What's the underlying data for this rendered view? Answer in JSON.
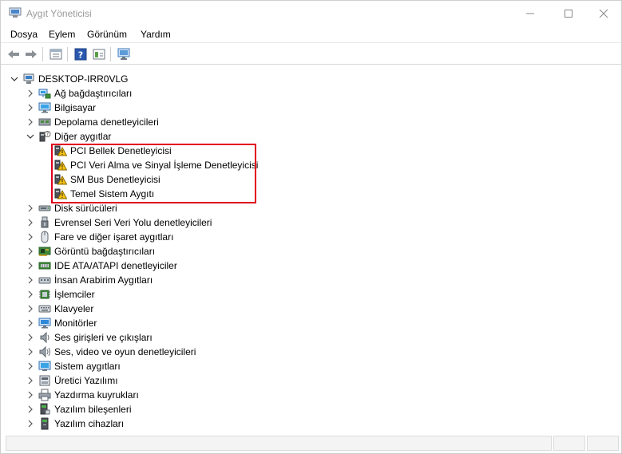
{
  "window": {
    "title": "Aygıt Yöneticisi",
    "controls": {
      "minimize": "—",
      "maximize": "☐",
      "close": "✕"
    }
  },
  "menu": {
    "items": [
      "Dosya",
      "Eylem",
      "Görünüm",
      "Yardım"
    ]
  },
  "toolbar": {
    "icons": [
      "back-arrow-icon",
      "forward-arrow-icon",
      "properties-icon",
      "help-icon",
      "view-icon",
      "scan-hardware-icon"
    ]
  },
  "tree": {
    "root": {
      "label": "DESKTOP-IRR0VLG",
      "icon": "computer-icon",
      "expanded": true
    },
    "categories": [
      {
        "label": "Ağ bağdaştırıcıları",
        "icon": "network-adapter-icon",
        "expanded": false
      },
      {
        "label": "Bilgisayar",
        "icon": "computer-monitor-icon",
        "expanded": false
      },
      {
        "label": "Depolama denetleyicileri",
        "icon": "storage-controller-icon",
        "expanded": false
      },
      {
        "label": "Diğer aygıtlar",
        "icon": "unknown-device-icon",
        "expanded": true,
        "children": [
          {
            "label": "PCI Bellek Denetleyicisi",
            "icon": "warning-device-icon"
          },
          {
            "label": "PCI Veri Alma ve Sinyal İşleme Denetleyicisi",
            "icon": "warning-device-icon"
          },
          {
            "label": "SM Bus Denetleyicisi",
            "icon": "warning-device-icon"
          },
          {
            "label": "Temel Sistem Aygıtı",
            "icon": "warning-device-icon"
          }
        ]
      },
      {
        "label": "Disk sürücüleri",
        "icon": "disk-drive-icon",
        "expanded": false
      },
      {
        "label": "Evrensel Seri Veri Yolu denetleyicileri",
        "icon": "usb-icon",
        "expanded": false
      },
      {
        "label": "Fare ve diğer işaret aygıtları",
        "icon": "mouse-icon",
        "expanded": false
      },
      {
        "label": "Görüntü bağdaştırıcıları",
        "icon": "display-adapter-icon",
        "expanded": false
      },
      {
        "label": "IDE ATA/ATAPI denetleyiciler",
        "icon": "ide-controller-icon",
        "expanded": false
      },
      {
        "label": "İnsan Arabirim Aygıtları",
        "icon": "hid-icon",
        "expanded": false
      },
      {
        "label": "İşlemciler",
        "icon": "processor-icon",
        "expanded": false
      },
      {
        "label": "Klavyeler",
        "icon": "keyboard-icon",
        "expanded": false
      },
      {
        "label": "Monitörler",
        "icon": "monitor-icon",
        "expanded": false
      },
      {
        "label": "Ses girişleri ve çıkışları",
        "icon": "speaker-icon",
        "expanded": false
      },
      {
        "label": "Ses, video ve oyun denetleyicileri",
        "icon": "sound-controller-icon",
        "expanded": false
      },
      {
        "label": "Sistem aygıtları",
        "icon": "system-device-icon",
        "expanded": false
      },
      {
        "label": "Üretici Yazılımı",
        "icon": "firmware-icon",
        "expanded": false
      },
      {
        "label": "Yazdırma kuyrukları",
        "icon": "printer-icon",
        "expanded": false
      },
      {
        "label": "Yazılım bileşenleri",
        "icon": "software-component-icon",
        "expanded": false
      },
      {
        "label": "Yazılım cihazları",
        "icon": "software-device-icon",
        "expanded": false
      }
    ]
  },
  "colors": {
    "highlight_border": "#e0001b",
    "title_text": "#9a9a9a",
    "toolbar_blue": "#1e5fb4"
  }
}
